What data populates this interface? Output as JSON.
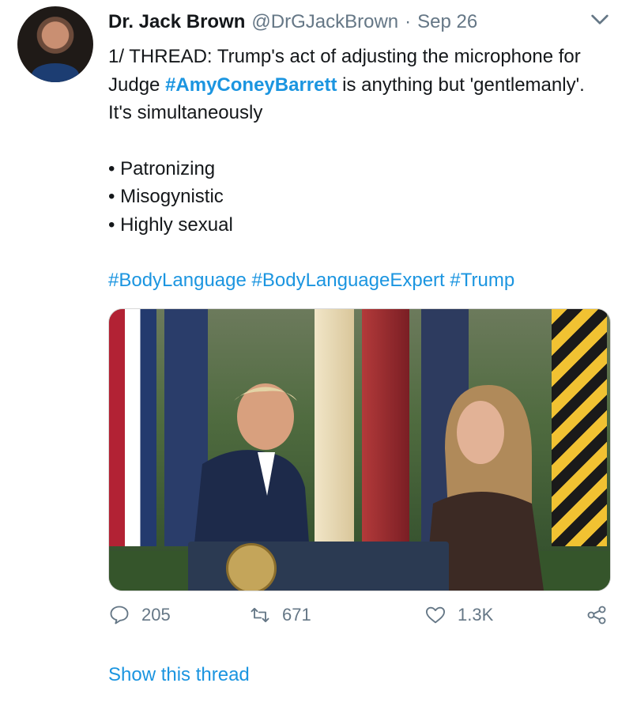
{
  "author": {
    "display_name": "Dr. Jack Brown",
    "handle": "@DrGJackBrown",
    "separator": "·",
    "date": "Sep 26"
  },
  "tweet": {
    "line_prefix": "1/ THREAD:  Trump's act of adjusting the microphone for Judge ",
    "hashtag_main": "#AmyConeyBarrett",
    "line_suffix": " is anything but 'gentlemanly'. It's simultaneously",
    "bullets": [
      "• Patronizing",
      "• Misogynistic",
      "• Highly sexual"
    ],
    "hashtags": [
      "#BodyLanguage",
      "#BodyLanguageExpert",
      "#Trump"
    ]
  },
  "actions": {
    "replies": "205",
    "retweets": "671",
    "likes": "1.3K"
  },
  "show_thread": "Show this thread",
  "icons": {
    "menu": "chevron-down-icon",
    "reply": "reply-icon",
    "retweet": "retweet-icon",
    "like": "heart-icon",
    "share": "share-icon"
  },
  "colors": {
    "link": "#1b95e0",
    "muted": "#657786",
    "text": "#14171a"
  }
}
